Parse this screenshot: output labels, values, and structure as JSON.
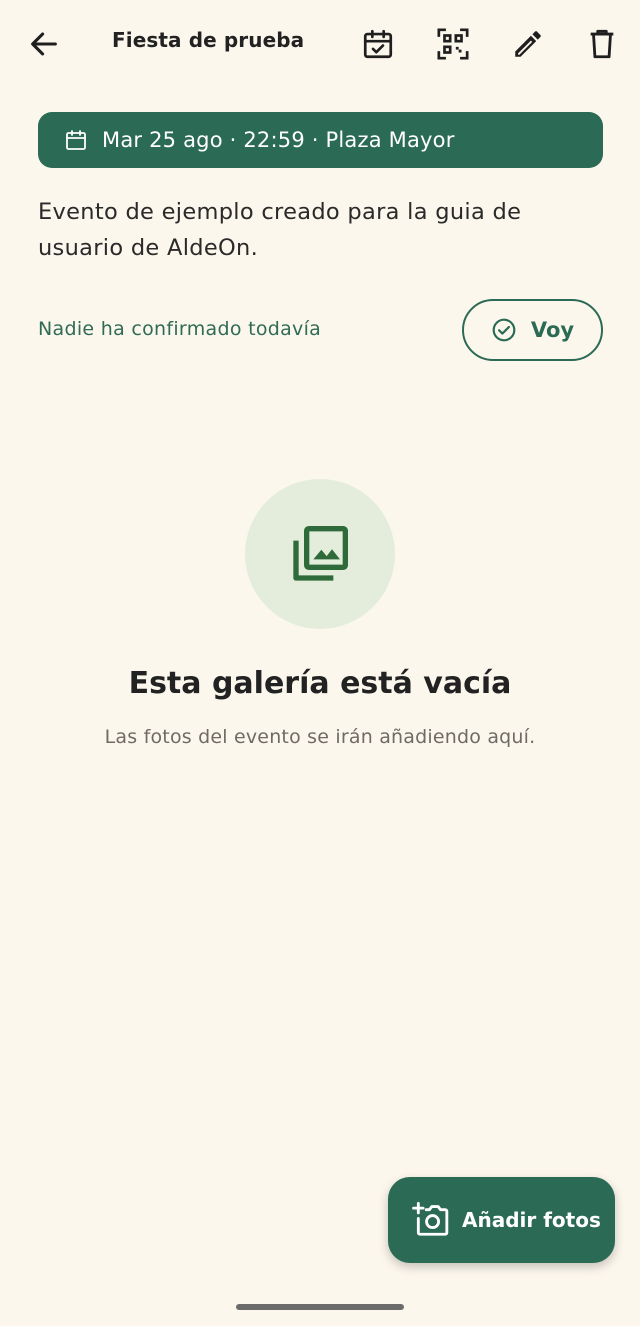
{
  "header": {
    "title": "Fiesta de prueba",
    "icons": [
      "back-arrow-icon",
      "calendar-check-icon",
      "qr-code-icon",
      "edit-pencil-icon",
      "delete-trash-icon"
    ]
  },
  "event": {
    "info": "Mar 25 ago · 22:59 · Plaza Mayor",
    "description": "Evento de ejemplo creado para la guia de usuario de AldeOn."
  },
  "rsvp": {
    "status": "Nadie ha confirmado todavía",
    "button_label": "Voy"
  },
  "gallery": {
    "empty_title": "Esta galería está vacía",
    "empty_subtitle": "Las fotos del evento se irán añadiendo aquí."
  },
  "fab": {
    "label": "Añadir fotos"
  },
  "colors": {
    "background": "#fcf7ed",
    "accent": "#2b6b56",
    "empty_circle": "#e4eddb"
  }
}
